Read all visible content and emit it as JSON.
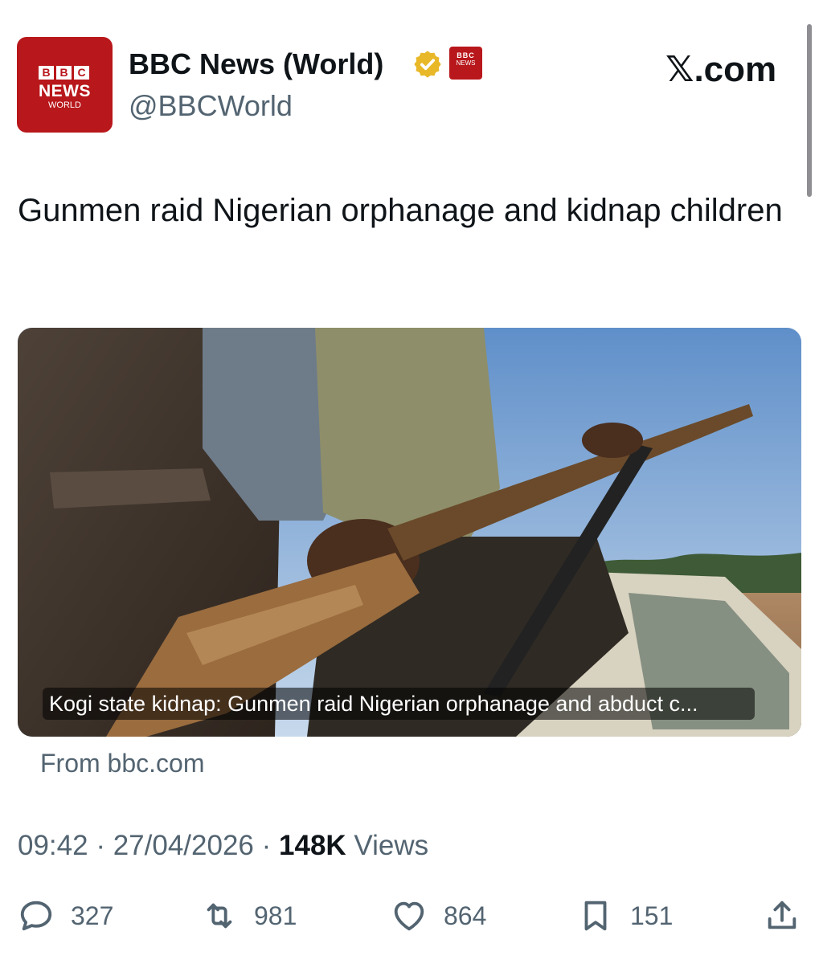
{
  "account": {
    "avatar_blocks": [
      "B",
      "B",
      "C"
    ],
    "avatar_news": "NEWS",
    "avatar_world": "WORLD",
    "display_name": "BBC News (World)",
    "handle": "@BBCWorld",
    "verified_color": "#e8b829",
    "affiliate_badge_top": "BBC",
    "affiliate_badge_bottom": "NEWS",
    "brand_color": "#b8171b"
  },
  "site_label": "𝕏.com",
  "tweet": {
    "text": "Gunmen raid Nigerian orphanage and kidnap children"
  },
  "card": {
    "caption": "Kogi state kidnap: Gunmen raid Nigerian orphanage and abduct c...",
    "source": "From bbc.com"
  },
  "meta": {
    "time": "09:42",
    "separator": "·",
    "date": "27/04/2026",
    "views_count": "148K",
    "views_label": "Views"
  },
  "actions": {
    "replies": "327",
    "reposts": "981",
    "likes": "864",
    "bookmarks": "151"
  },
  "icons": {
    "verified": "verified-badge-icon",
    "reply": "reply-icon",
    "repost": "repost-icon",
    "like": "heart-icon",
    "bookmark": "bookmark-icon",
    "share": "share-icon"
  }
}
